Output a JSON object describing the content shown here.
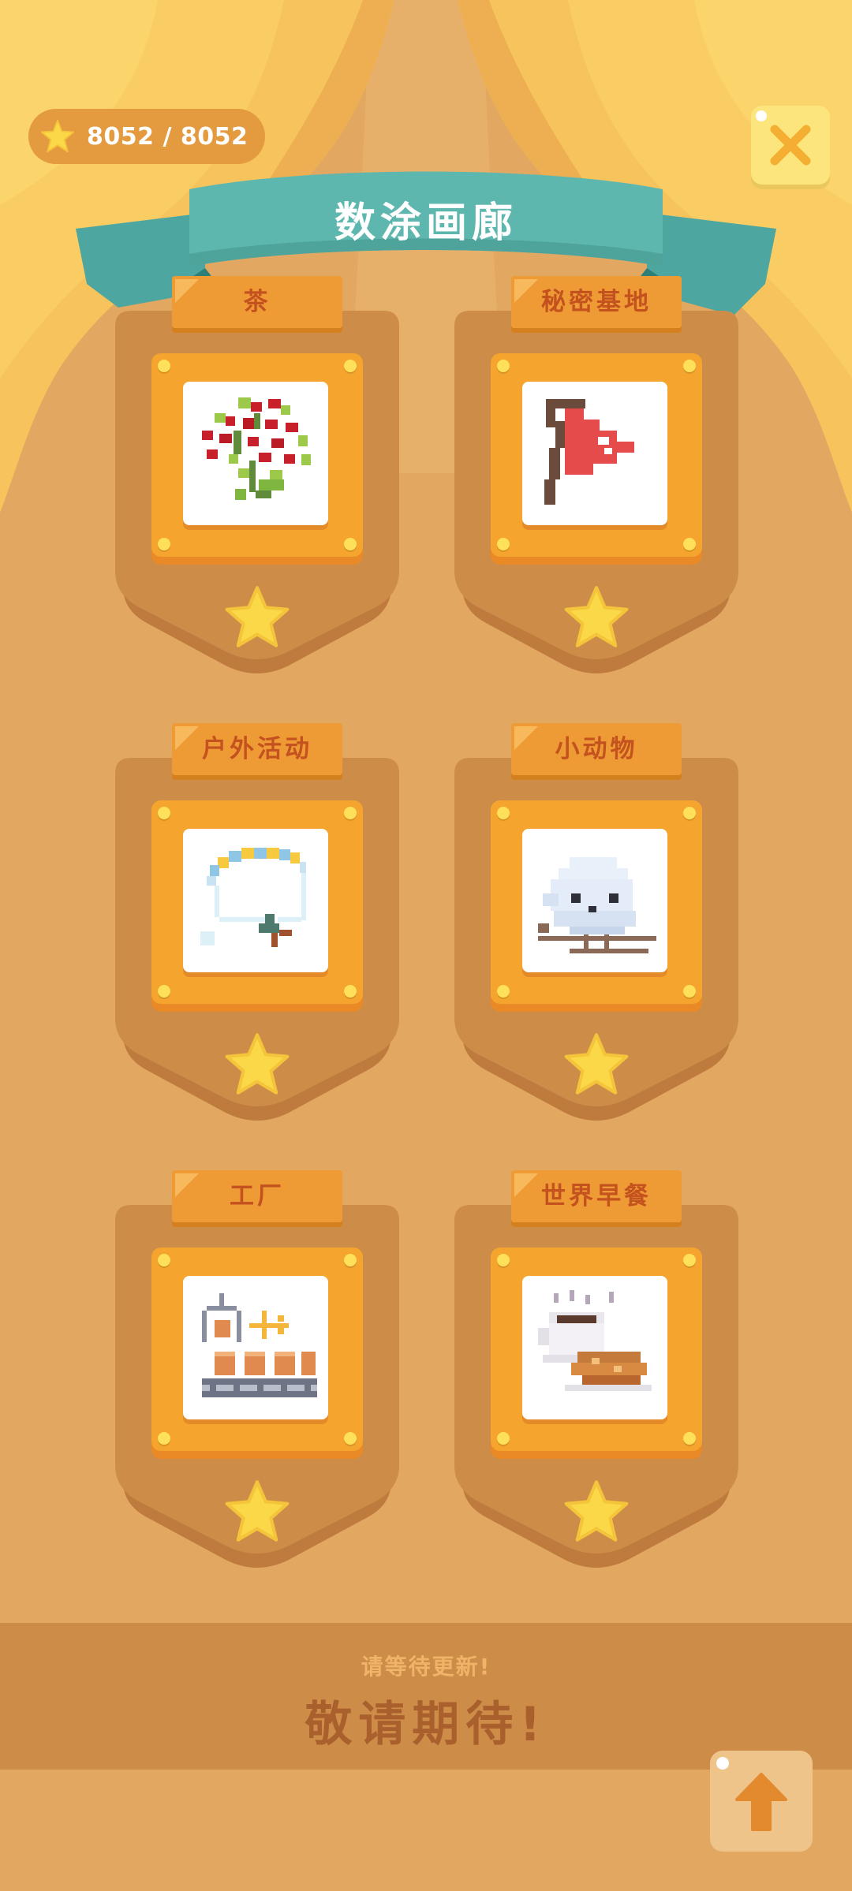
{
  "stars": {
    "count_text": "8052 / 8052"
  },
  "header": {
    "title": "数涂画廊"
  },
  "albums": [
    {
      "label": "茶",
      "picture": "tea-plant"
    },
    {
      "label": "秘密基地",
      "picture": "red-flag"
    },
    {
      "label": "户外活动",
      "picture": "paraglider"
    },
    {
      "label": "小动物",
      "picture": "white-bird"
    },
    {
      "label": "工厂",
      "picture": "factory-conveyor"
    },
    {
      "label": "世界早餐",
      "picture": "coffee-croissant"
    }
  ],
  "footer": {
    "subtitle": "请等待更新!",
    "title": "敬请期待!"
  },
  "colors": {
    "background": "#E2A862",
    "banner": "#5EB7AE",
    "tab": "#EE9A35",
    "frame": "#F5A52E",
    "star": "#FBD848"
  },
  "icons": {
    "close": "close-icon",
    "scroll_top": "arrow-up-icon",
    "star": "star-icon"
  }
}
